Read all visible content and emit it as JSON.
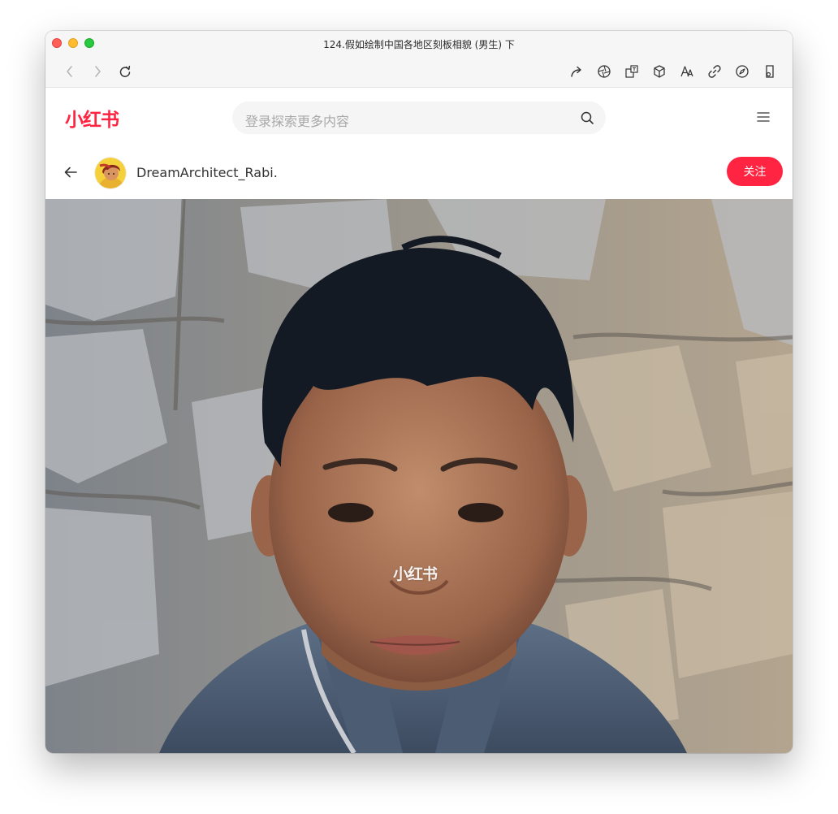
{
  "window": {
    "title": "124.假如绘制中国各地区刻板相貌 (男生) 下"
  },
  "toolbar": {
    "icons": [
      "chevron-left-icon",
      "chevron-right-icon",
      "reload-icon",
      "share-icon",
      "aperture-icon",
      "translate-icon",
      "cube-icon",
      "text-size-icon",
      "link-icon",
      "compass-icon",
      "reader-icon"
    ]
  },
  "site": {
    "logo": "小红书",
    "search_placeholder": "登录探索更多内容",
    "brand_color": "#ff2442"
  },
  "author": {
    "name": "DreamArchitect_Rabi.",
    "follow_label": "关注"
  },
  "photo": {
    "watermark": "小红书"
  }
}
